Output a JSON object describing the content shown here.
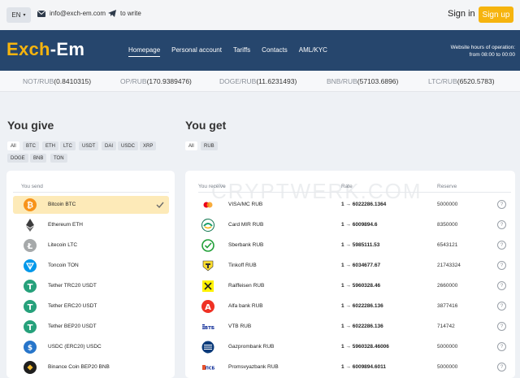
{
  "topbar": {
    "lang": "EN",
    "email": "info@exch-em.com",
    "write": "to write",
    "sign_in": "Sign in",
    "sign_up": "Sign up"
  },
  "nav": {
    "logo_part1": "Exch",
    "logo_part2": "-Em",
    "menu": [
      "Homepage",
      "Personal account",
      "Tariffs",
      "Contacts",
      "AML/KYC"
    ],
    "hours_line1": "Website hours of operation:",
    "hours_line2": "from 08:00 to 00:00"
  },
  "ticker": [
    {
      "pair": "NOT/RUB",
      "value": "(0.8410315)"
    },
    {
      "pair": "OP/RUB",
      "value": "(170.9389476)"
    },
    {
      "pair": "DOGE/RUB",
      "value": "(11.6231493)"
    },
    {
      "pair": "BNB/RUB",
      "value": "(57103.6896)"
    },
    {
      "pair": "LTC/RUB",
      "value": "(6520.5783)"
    }
  ],
  "give": {
    "title": "You give",
    "filters_row1": [
      "All",
      "BTC",
      "ETH",
      "LTC",
      "USDT",
      "DAI",
      "USDC",
      "XRP"
    ],
    "filters_row2": [
      "DOGE",
      "BNB",
      "TON"
    ],
    "col_send": "You send",
    "items": [
      {
        "name": "Bitcoin BTC",
        "icon": "bitcoin-icon",
        "color": "#f7931a",
        "selected": true
      },
      {
        "name": "Ethereum ETH",
        "icon": "ethereum-icon",
        "color": "#3c3c3d",
        "selected": false
      },
      {
        "name": "Litecoin LTC",
        "icon": "litecoin-icon",
        "color": "#a6a9aa",
        "selected": false
      },
      {
        "name": "Toncoin TON",
        "icon": "toncoin-icon",
        "color": "#0098ea",
        "selected": false
      },
      {
        "name": "Tether TRC20 USDT",
        "icon": "tether-icon",
        "color": "#26a17b",
        "selected": false
      },
      {
        "name": "Tether ERC20 USDT",
        "icon": "tether-icon",
        "color": "#26a17b",
        "selected": false
      },
      {
        "name": "Tether BEP20 USDT",
        "icon": "tether-icon",
        "color": "#26a17b",
        "selected": false
      },
      {
        "name": "USDC (ERC20) USDC",
        "icon": "usdc-icon",
        "color": "#2775ca",
        "selected": false
      },
      {
        "name": "Binance Coin BEP20 BNB",
        "icon": "bnb-icon",
        "color": "#f3ba2f",
        "selected": false
      }
    ]
  },
  "get": {
    "title": "You get",
    "filters": [
      "All",
      "RUB"
    ],
    "col_receive": "You receive",
    "col_rate": "Rate",
    "col_reserve": "Reserve",
    "help": "?",
    "items": [
      {
        "name": "VISA/MC RUB",
        "rate": "1 → 6022286.1364",
        "reserve": "5000000",
        "icon": "visa-mc-icon"
      },
      {
        "name": "Card MIR RUB",
        "rate": "1 → 6009894.6",
        "reserve": "8350000",
        "icon": "mir-icon"
      },
      {
        "name": "Sberbank RUB",
        "rate": "1 → 5985111.53",
        "reserve": "6543121",
        "icon": "sberbank-icon"
      },
      {
        "name": "Tinkoff RUB",
        "rate": "1 → 6034677.67",
        "reserve": "21743324",
        "icon": "tinkoff-icon"
      },
      {
        "name": "Raiffeisen RUB",
        "rate": "1 → 5960328.46",
        "reserve": "2660000",
        "icon": "raiffeisen-icon"
      },
      {
        "name": "Alfa bank RUB",
        "rate": "1 → 6022286.136",
        "reserve": "3877416",
        "icon": "alfa-icon"
      },
      {
        "name": "VTB RUB",
        "rate": "1 → 6022286.136",
        "reserve": "714742",
        "icon": "vtb-icon"
      },
      {
        "name": "Gazprombank RUB",
        "rate": "1 → 5960328.46006",
        "reserve": "5000000",
        "icon": "gazprom-icon"
      },
      {
        "name": "Promsvyazbank RUB",
        "rate": "1 → 6009894.6011",
        "reserve": "5000000",
        "icon": "psb-icon"
      }
    ]
  },
  "watermark": "CRYPTWERK.COM",
  "colors": {
    "accent": "#f6b40e",
    "nav": "#26466d"
  }
}
